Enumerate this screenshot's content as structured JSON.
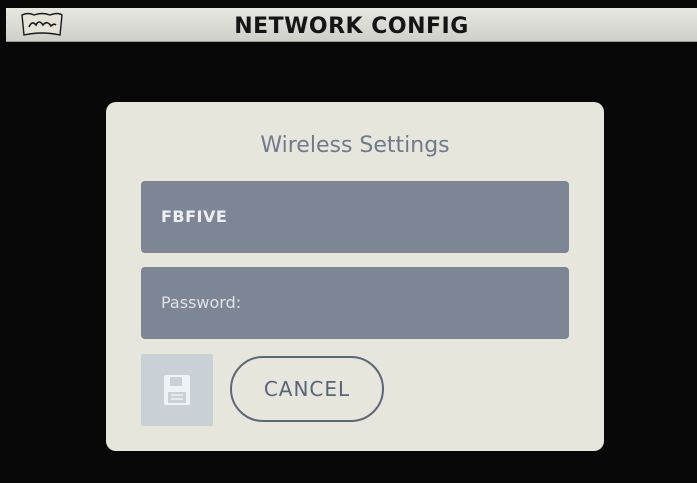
{
  "header": {
    "title": "NETWORK CONFIG",
    "logo_icon": "brand-logo-icon"
  },
  "dialog": {
    "title": "Wireless Settings",
    "ssid_value": "FBFIVE",
    "password_placeholder": "Password:",
    "save_icon": "floppy-disk-icon",
    "cancel_label": "CANCEL"
  },
  "colors": {
    "background": "#080808",
    "header_bg": "#dcdcd6",
    "dialog_bg": "#e7e6dd",
    "field_bg": "#7d8694",
    "accent": "#6f7a8b"
  }
}
